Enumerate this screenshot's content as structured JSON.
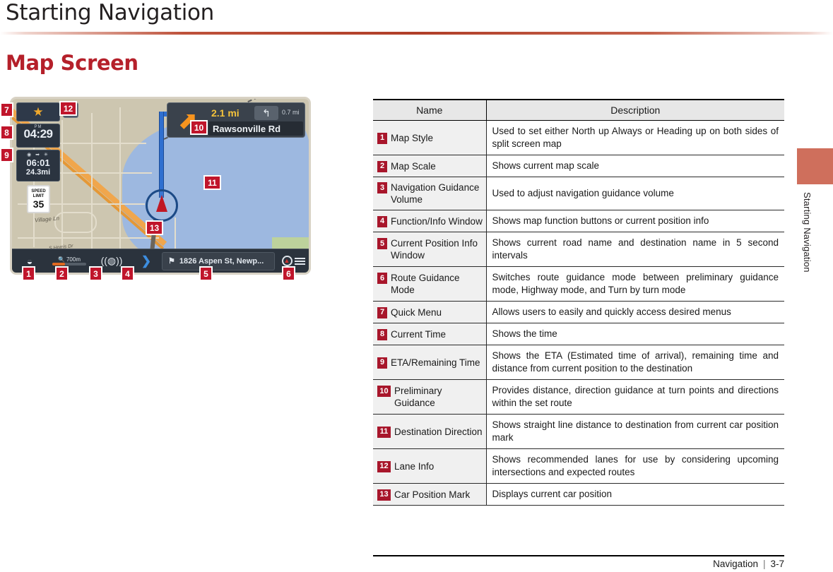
{
  "header": {
    "chapter_title": "Starting Navigation",
    "section_title": "Map Screen",
    "side_tab_label": "Starting Navigation"
  },
  "footer": {
    "section": "Navigation",
    "separator": "|",
    "page": "3-7"
  },
  "map_figure": {
    "quick_menu_icon": "star-icon",
    "lane_info_icon": "lane-arrow-icon",
    "clock": {
      "ampm": "PM",
      "time": "04:29"
    },
    "eta": {
      "icons": "◉ ➡ ✳",
      "time": "06:01",
      "distance": "24.3mi"
    },
    "speed_limit": {
      "line1": "SPEED",
      "line2": "LIMIT",
      "value": "35"
    },
    "preliminary_guidance": {
      "turn_arrow": "turn-right-arrow-icon",
      "distance": "2.1 mi",
      "second_turn_icon": "u-turn-left-icon",
      "second_distance": "0.7 mi",
      "road_name": "Rawsonville Rd"
    },
    "street_labels": {
      "village": "Village Ln",
      "horris": "S Horris Dr"
    },
    "bottom_bar": {
      "map_style_icon": "map-style-icon",
      "scale_icon": "magnifier-icon",
      "scale_value": "700m",
      "volume_icon": "speaker-volume-icon",
      "expand_icon": "chevron-right-icon",
      "destination_icon": "checkered-flag-icon",
      "destination_text": "1826 Aspen St, Newp...",
      "route_mode_icon": "compass-icon",
      "menu_icon": "hamburger-menu-icon"
    },
    "callouts": [
      "1",
      "2",
      "3",
      "4",
      "5",
      "6",
      "7",
      "8",
      "9",
      "10",
      "11",
      "12",
      "13"
    ]
  },
  "table": {
    "headers": {
      "name": "Name",
      "description": "Description"
    },
    "rows": [
      {
        "num": "1",
        "name": "Map Style",
        "desc": "Used to set either North up Always or Heading up on both sides of split screen map"
      },
      {
        "num": "2",
        "name": "Map Scale",
        "desc": "Shows current map scale"
      },
      {
        "num": "3",
        "name": "Navigation Guidance Volume",
        "desc": "Used to adjust navigation guidance volume"
      },
      {
        "num": "4",
        "name": "Function/Info Window",
        "desc": "Shows map function buttons or current position info"
      },
      {
        "num": "5",
        "name": "Current Position Info Window",
        "desc": "Shows current road name and destination name in 5 second intervals"
      },
      {
        "num": "6",
        "name": "Route Guidance Mode",
        "desc": "Switches route guidance mode between preliminary guidance mode, Highway mode, and Turn by turn mode"
      },
      {
        "num": "7",
        "name": "Quick Menu",
        "desc": "Allows users to easily and quickly access desired menus"
      },
      {
        "num": "8",
        "name": "Current Time",
        "desc": "Shows the time"
      },
      {
        "num": "9",
        "name": "ETA/Remaining Time",
        "desc": "Shows the ETA (Estimated time of arrival), remaining time and distance from current position to the destination"
      },
      {
        "num": "10",
        "name": "Preliminary Guidance",
        "desc": "Provides distance, direction guidance at turn points and directions within the set route"
      },
      {
        "num": "11",
        "name": "Destination Direction",
        "desc": "Shows straight line distance to destination from current car position mark"
      },
      {
        "num": "12",
        "name": "Lane Info",
        "desc": "Shows recommended lanes for use by considering upcoming intersections and expected routes"
      },
      {
        "num": "13",
        "name": "Car Position Mark",
        "desc": "Displays current car position"
      }
    ]
  },
  "colors": {
    "accent_red": "#b5202a",
    "badge_red": "#c0152b",
    "table_badge_red": "#a8162b",
    "side_tab": "#cf6f5c"
  }
}
